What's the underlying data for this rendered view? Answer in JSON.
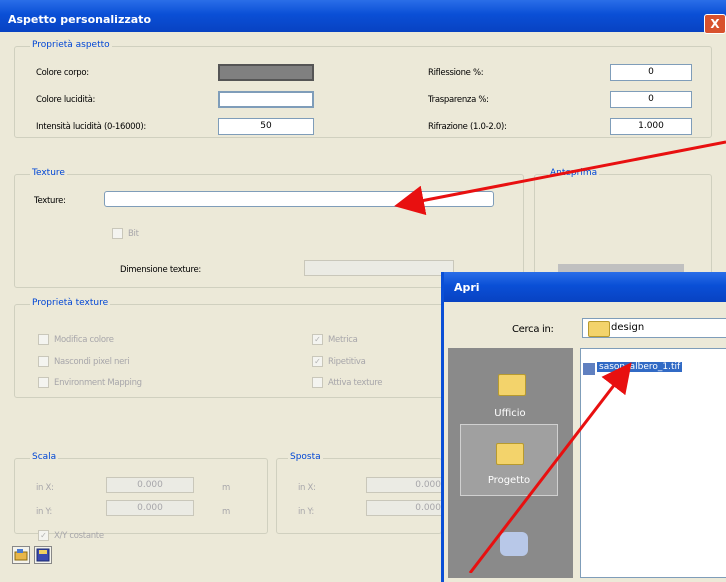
{
  "window": {
    "title": "Aspetto personalizzato",
    "close_label": "X"
  },
  "aspect": {
    "group_title": "Proprietà aspetto",
    "colore_corpo": "Colore corpo:",
    "colore_lucidita": "Colore lucidità:",
    "intensita": "Intensità lucidità (0-16000):",
    "intensita_value": "50",
    "riflessione": "Riflessione %:",
    "riflessione_value": "0",
    "trasparenza": "Trasparenza %:",
    "trasparenza_value": "0",
    "rifrazione": "Rifrazione (1.0-2.0):",
    "rifrazione_value": "1.000"
  },
  "texture": {
    "group_title": "Texture",
    "label": "Texture:",
    "value": "",
    "bit_label": "Bit",
    "dimensione_label": "Dimensione texture:",
    "dimensione_value": ""
  },
  "anteprima": {
    "title": "Anteprima"
  },
  "texture_props": {
    "group_title": "Proprietà texture",
    "modifica_colore": "Modifica colore",
    "nascondi": "Nascondi pixel neri",
    "environment": "Environment Mapping",
    "metrica": "Metrica",
    "ripetitiva": "Ripetitiva",
    "attiva": "Attiva texture"
  },
  "scala": {
    "title": "Scala",
    "x_label": "in X:",
    "x_value": "0.000",
    "x_unit": "m",
    "y_label": "in Y:",
    "y_value": "0.000",
    "y_unit": "m",
    "costante": "X/Y costante"
  },
  "sposta": {
    "title": "Sposta",
    "x_label": "in X:",
    "x_value": "0.000",
    "y_label": "in Y:",
    "y_value": "0.000"
  },
  "apri": {
    "title": "Apri",
    "cerca_label": "Cerca in:",
    "cerca_value": "design",
    "places": [
      "Ufficio",
      "Progetto"
    ],
    "file": "sason_albero_1.tif"
  },
  "colors": {
    "accent_arrow": "#e81010",
    "title_blue": "#0a4fd6"
  }
}
